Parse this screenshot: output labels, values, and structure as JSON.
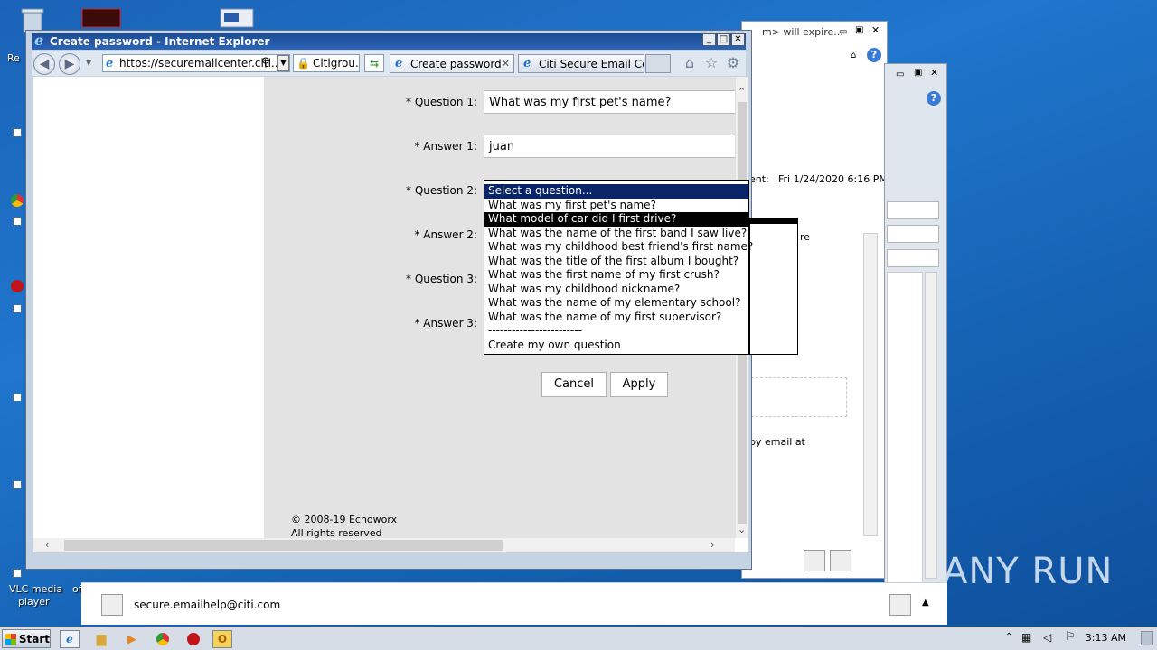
{
  "desktop": {
    "labels": [
      "Re",
      "VLC media",
      "player",
      "of"
    ]
  },
  "background_window": {
    "notification": "m> will expire...",
    "sent_label": "ent:",
    "sent_value": "Fri 1/24/2020 6:16 PM",
    "body_fragment": "re",
    "body_fragment2": "by email at",
    "sender_email": "secure.emailhelp@citi.com"
  },
  "ie": {
    "title": "Create password - Internet Explorer",
    "address": "https://securemailcenter.citi...",
    "security_label": "Citigrou...",
    "tabs": [
      {
        "label": "Create password"
      },
      {
        "label": "Citi Secure Email Ce..."
      }
    ]
  },
  "form": {
    "question1_label": "* Question 1:",
    "question1_value": "What was my first pet's name?",
    "answer1_label": "* Answer 1:",
    "answer1_value": "juan",
    "question2_label": "* Question 2:",
    "answer2_label": "* Answer 2:",
    "question3_label": "* Question 3:",
    "answer3_label": "* Answer 3:",
    "cancel_label": "Cancel",
    "apply_label": "Apply",
    "copyright_line1": "© 2008-19 Echoworx",
    "copyright_line2": "All rights reserved"
  },
  "dropdown": {
    "options": [
      "Select a question...",
      "What was my first pet's name?",
      "What model of car did I first drive?",
      "What was the name of the first band I saw live?",
      "What was my childhood best friend's first name?",
      "What was the title of the first album I bought?",
      "What was the first name of my first crush?",
      "What was my childhood nickname?",
      "What was the name of my elementary school?",
      "What was the name of my first supervisor?",
      "------------------------",
      "Create my own question"
    ],
    "selected_index": 0,
    "hover_index": 2
  },
  "taskbar": {
    "start_label": "Start",
    "clock": "3:13 AM"
  },
  "watermark": "ANY RUN"
}
